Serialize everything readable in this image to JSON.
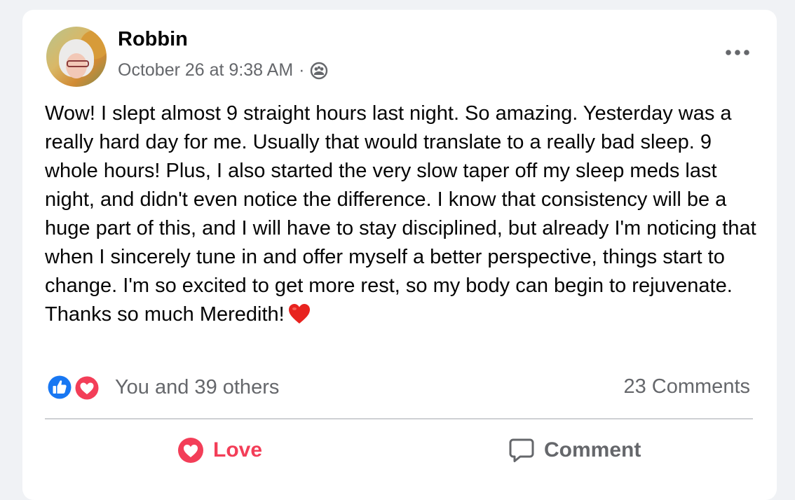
{
  "post": {
    "author": "Robbin",
    "timestamp": "October 26 at 9:38 AM",
    "separator": "·",
    "privacy_icon": "friends-icon",
    "body": "Wow! I slept almost 9 straight hours last night.  So amazing. Yesterday was a really hard day for me. Usually that would translate to a really bad sleep.  9 whole hours! Plus, I also started the very slow taper off my sleep meds last night, and didn't even notice the difference.  I know that consistency will be a huge part of this, and I will have to stay disciplined, but already I'm noticing that when I sincerely tune in and offer myself a better perspective, things start to change.  I'm so excited to get more rest, so my body can begin to rejuvenate. Thanks so much Meredith!",
    "trailing_emoji": "red-heart-emoji"
  },
  "reactions": {
    "icons": [
      "like-reaction-icon",
      "love-reaction-icon"
    ],
    "summary": "You and 39 others"
  },
  "comments": {
    "count_label": "23 Comments"
  },
  "actions": {
    "love_label": "Love",
    "comment_label": "Comment"
  },
  "colors": {
    "background": "#f0f2f5",
    "card": "#ffffff",
    "text_primary": "#050505",
    "text_secondary": "#65676b",
    "like_blue": "#1877f2",
    "love_red": "#f33e58",
    "divider": "#ced0d4"
  }
}
